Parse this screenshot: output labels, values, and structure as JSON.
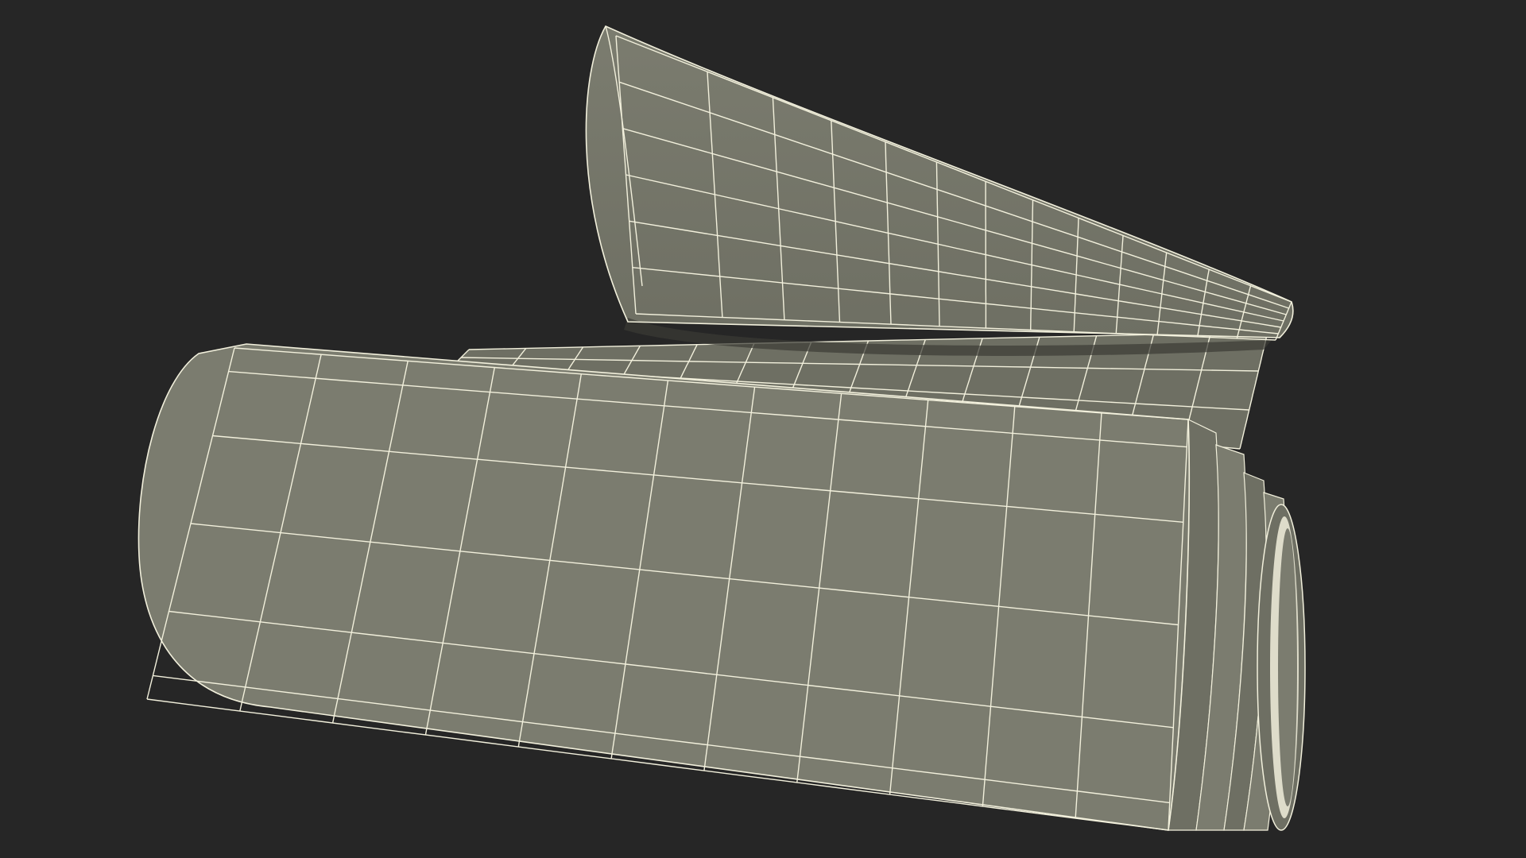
{
  "scene": {
    "subject": "rolled-paper-wireframe-render",
    "background_color": "#262626",
    "surface_color": "#7b7c6f",
    "surface_shade_color": "#6e6f63",
    "wire_color": "#f2f0dc",
    "shadow_color": "#3a3a35"
  }
}
